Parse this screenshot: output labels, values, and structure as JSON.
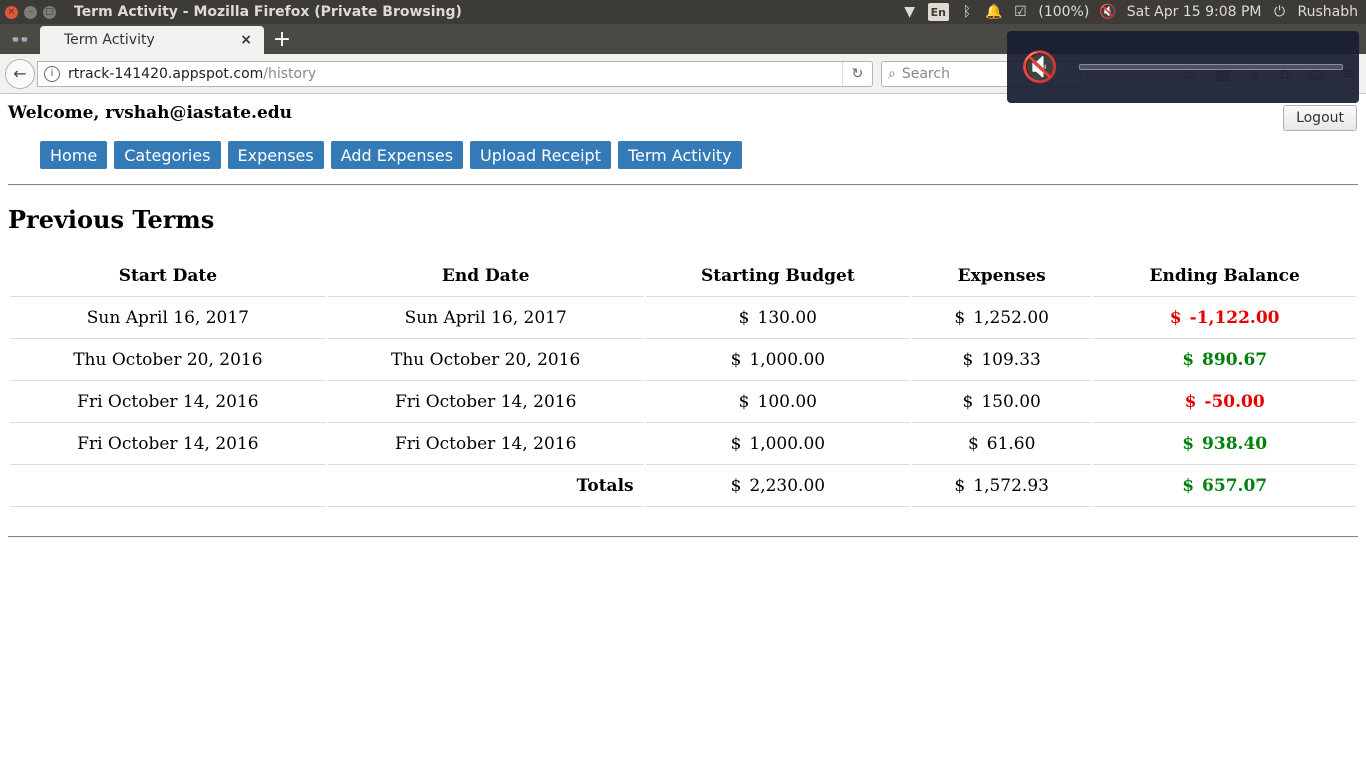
{
  "window": {
    "title": "Term Activity - Mozilla Firefox (Private Browsing)",
    "controls": {
      "close": "×",
      "minimize": "–",
      "maximize": "□"
    }
  },
  "os_indicators": {
    "wifi_icon": "▼",
    "keyboard_lang": "En",
    "bluetooth_icon": "ᛒ",
    "bell_icon": "🔔",
    "clipboard_icon": "☑",
    "battery": "(100%)",
    "volume_icon": "🔇",
    "clock": "Sat Apr 15  9:08 PM",
    "user": "Rushabh",
    "power_icon": "⏻"
  },
  "browser": {
    "private_icon": "👓",
    "tab_label": "Term Activity",
    "tab_close": "×",
    "new_tab": "+",
    "back_icon": "←",
    "info_icon": "i",
    "url_host": "rtrack-141420.appspot.com",
    "url_path": "/history",
    "reload_icon": "↻",
    "search_placeholder": "Search",
    "search_icon": "⌕",
    "toolbar_icons": [
      "☆",
      "▤",
      "⇩",
      "⌂",
      "☺",
      "≡"
    ]
  },
  "volume_osd": {
    "icon": "🔇",
    "level": 0,
    "muted": true
  },
  "page": {
    "welcome": "Welcome, rvshah@iastate.edu",
    "logout_label": "Logout",
    "nav_items": [
      "Home",
      "Categories",
      "Expenses",
      "Add Expenses",
      "Upload Receipt",
      "Term Activity"
    ],
    "title": "Previous Terms",
    "colors": {
      "negative": "#e60000",
      "positive": "#00800a",
      "nav_button": "#337ab7"
    },
    "table": {
      "headers": [
        "Start Date",
        "End Date",
        "Starting Budget",
        "Expenses",
        "Ending Balance"
      ],
      "currency": "$",
      "rows": [
        {
          "start": "Sun April 16, 2017",
          "end": "Sun April 16, 2017",
          "budget": "130.00",
          "expenses": "1,252.00",
          "balance": "-1,122.00",
          "status": "negative"
        },
        {
          "start": "Thu October 20, 2016",
          "end": "Thu October 20, 2016",
          "budget": "1,000.00",
          "expenses": "109.33",
          "balance": "890.67",
          "status": "positive"
        },
        {
          "start": "Fri October 14, 2016",
          "end": "Fri October 14, 2016",
          "budget": "100.00",
          "expenses": "150.00",
          "balance": "-50.00",
          "status": "negative"
        },
        {
          "start": "Fri October 14, 2016",
          "end": "Fri October 14, 2016",
          "budget": "1,000.00",
          "expenses": "61.60",
          "balance": "938.40",
          "status": "positive"
        }
      ],
      "totals": {
        "label": "Totals",
        "budget": "2,230.00",
        "expenses": "1,572.93",
        "balance": "657.07",
        "status": "positive"
      }
    }
  }
}
